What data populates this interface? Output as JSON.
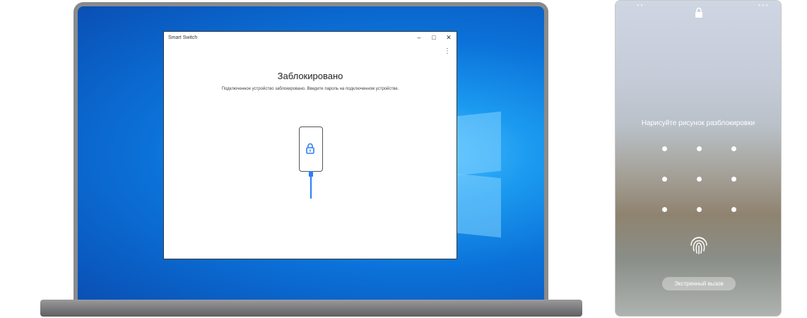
{
  "laptop": {
    "window": {
      "title": "Smart Switch",
      "controls": {
        "minimize": "–",
        "maximize": "□",
        "close": "✕"
      },
      "menu_icon": "⋮",
      "heading": "Заблокировано",
      "description": "Подключенное устройство заблокировано. Введите пароль на подключенном устройстве.",
      "accent_color": "#2e7cf6"
    }
  },
  "phone": {
    "prompt": "Нарисуйте рисунок разблокировки",
    "emergency_call": "Экстренный вызов",
    "icons": [
      "lock-icon",
      "fingerprint-icon"
    ]
  }
}
